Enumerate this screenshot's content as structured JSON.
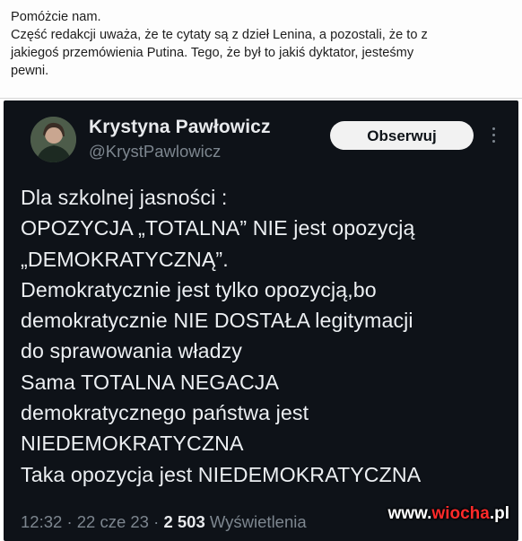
{
  "caption": {
    "lines": [
      "Pomóżcie nam.",
      "Część redakcji uważa, że te cytaty są z dzieł Lenina, a pozostali, że to z",
      "jakiegoś przemówienia Putina. Tego, że był to jakiś dyktator, jesteśmy",
      "pewni."
    ]
  },
  "tweet": {
    "author_name": "Krystyna Pawłowicz",
    "author_handle": "@KrystPawlowicz",
    "follow_label": "Obserwuj",
    "body_lines": [
      "Dla szkolnej jasności :",
      "OPOZYCJA „TOTALNA” NIE jest opozycją",
      "„DEMOKRATYCZNĄ”.",
      "Demokratycznie jest tylko opozycją,bo",
      "demokratycznie NIE DOSTAŁA legitymacji",
      "do sprawowania władzy",
      "Sama TOTALNA NEGACJA",
      "demokratycznego państwa jest",
      "NIEDEMOKRATYCZNA",
      "Taka opozycja jest NIEDEMOKRATYCZNA"
    ],
    "time": "12:32",
    "date": "22 cze 23",
    "views_count": "2 503",
    "views_label": "Wyświetlenia",
    "separator": "·"
  },
  "watermark": {
    "part1": "www.",
    "part2": "wiocha",
    "part3": ".pl"
  },
  "colors": {
    "tweet_bg": "#0e1218",
    "text": "#eceff2",
    "muted": "#7d868f",
    "watermark_accent": "#ff2a2a"
  }
}
